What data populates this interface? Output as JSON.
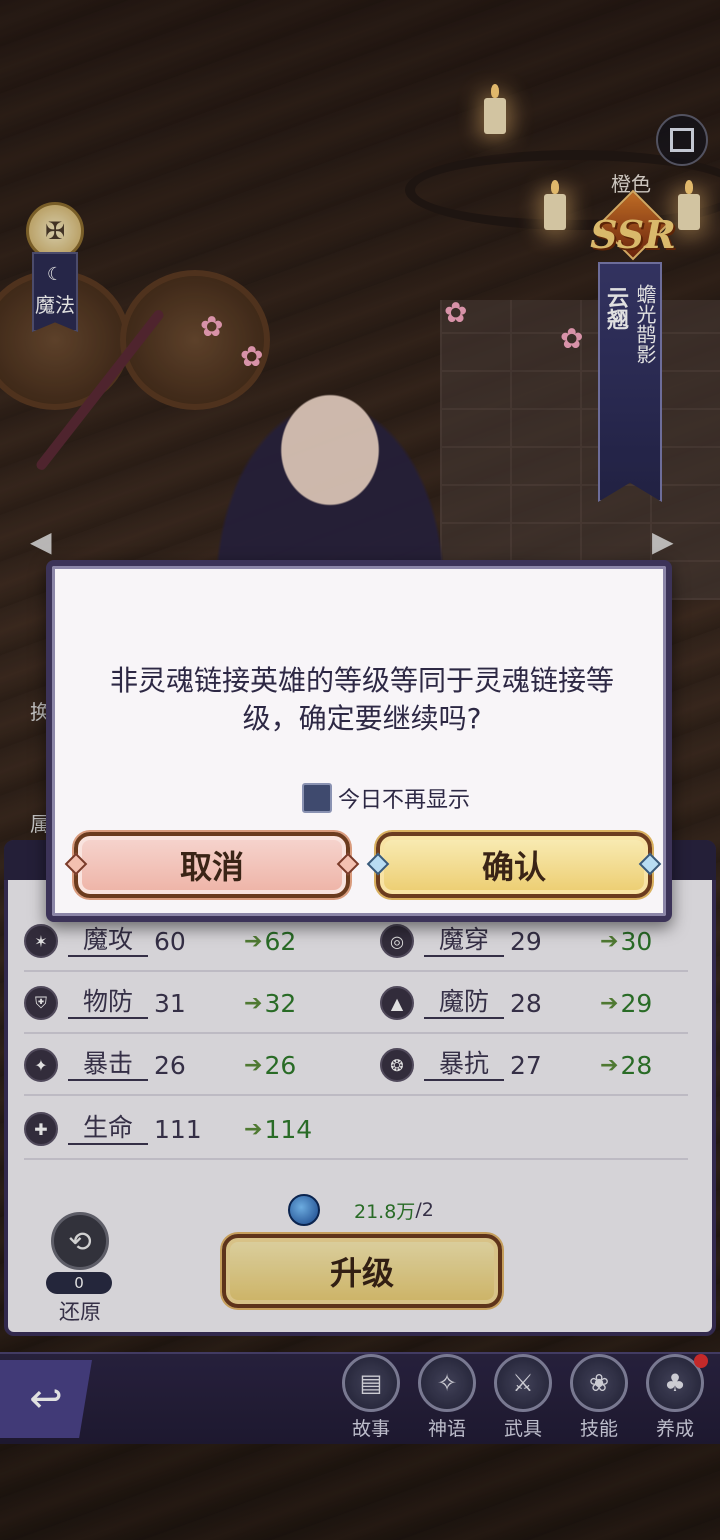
{
  "hero": {
    "element_label": "魔法",
    "color_label": "橙色",
    "rarity": "SSR",
    "title": "蟾光鹊影",
    "name": "云翘"
  },
  "side_tabs": {
    "tab1": "换",
    "tab2": "属"
  },
  "stats": [
    {
      "icon": "magic-attack-icon",
      "name": "魔攻",
      "value": "60",
      "next": "62"
    },
    {
      "icon": "magic-pierce-icon",
      "name": "魔穿",
      "value": "29",
      "next": "30"
    },
    {
      "icon": "physical-defense-icon",
      "name": "物防",
      "value": "31",
      "next": "32"
    },
    {
      "icon": "magic-defense-icon",
      "name": "魔防",
      "value": "28",
      "next": "29"
    },
    {
      "icon": "crit-icon",
      "name": "暴击",
      "value": "26",
      "next": "26"
    },
    {
      "icon": "crit-resist-icon",
      "name": "暴抗",
      "value": "27",
      "next": "28"
    },
    {
      "icon": "health-icon",
      "name": "生命",
      "value": "111",
      "next": "114"
    }
  ],
  "upgrade": {
    "cost_owned": "21.8万",
    "cost_required": "/2",
    "button_label": "升级"
  },
  "reset": {
    "count": "0",
    "label": "还原"
  },
  "bottom_nav": [
    {
      "icon": "book-icon",
      "label": "故事"
    },
    {
      "icon": "myth-icon",
      "label": "神语"
    },
    {
      "icon": "weapon-icon",
      "label": "武具"
    },
    {
      "icon": "skill-icon",
      "label": "技能"
    },
    {
      "icon": "tree-icon",
      "label": "养成",
      "has_badge": true
    }
  ],
  "dialog": {
    "message": "非灵魂链接英雄的等级等同于灵魂链接等级，确定要继续吗?",
    "checkbox_label": "今日不再显示",
    "checkbox_checked": false,
    "cancel_label": "取消",
    "confirm_label": "确认"
  }
}
